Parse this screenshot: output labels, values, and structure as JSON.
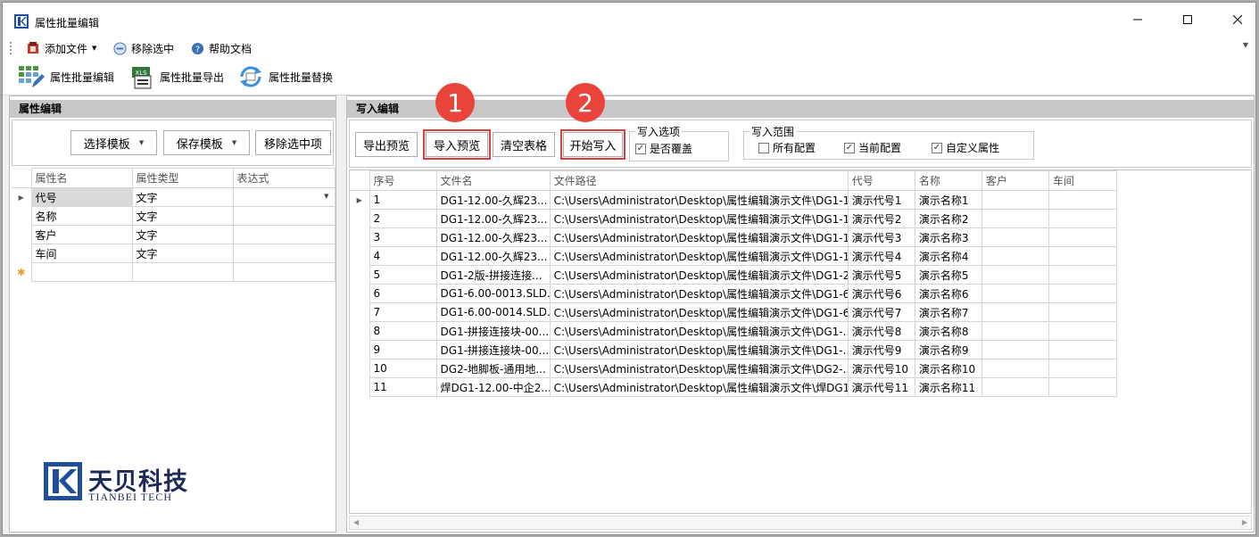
{
  "window": {
    "title": "属性批量编辑"
  },
  "menu": {
    "add_file": "添加文件",
    "remove_selected": "移除选中",
    "help_doc": "帮助文档"
  },
  "ribbon": {
    "batch_edit": "属性批量编辑",
    "batch_export": "属性批量导出",
    "batch_replace": "属性批量替换"
  },
  "left_panel": {
    "title": "属性编辑",
    "select_template": "选择模板",
    "save_template": "保存模板",
    "remove_item": "移除选中项",
    "columns": [
      "属性名",
      "属性类型",
      "表达式"
    ],
    "rows": [
      {
        "name": "代号",
        "type": "文字",
        "expr": ""
      },
      {
        "name": "名称",
        "type": "文字",
        "expr": ""
      },
      {
        "name": "客户",
        "type": "文字",
        "expr": ""
      },
      {
        "name": "车间",
        "type": "文字",
        "expr": ""
      }
    ],
    "new_row_marker": "✱"
  },
  "logo": {
    "cn": "天贝科技",
    "en": "TIANBEI TECH"
  },
  "right_panel": {
    "title": "写入编辑",
    "export_preview": "导出预览",
    "import_preview": "导入预览",
    "clear_table": "清空表格",
    "start_write": "开始写入",
    "write_options": {
      "legend": "写入选项",
      "overwrite": "是否覆盖",
      "overwrite_checked": true
    },
    "write_scope": {
      "legend": "写入范围",
      "all_config": "所有配置",
      "all_checked": false,
      "current_config": "当前配置",
      "current_checked": true,
      "custom_props": "自定义属性",
      "custom_checked": true
    },
    "badge1": "1",
    "badge2": "2",
    "columns": [
      "序号",
      "文件名",
      "文件路径",
      "代号",
      "名称",
      "客户",
      "车间"
    ],
    "rows": [
      [
        "1",
        "DG1-12.00-久辉23...",
        "C:\\Users\\Administrator\\Desktop\\属性编辑演示文件\\DG1-1...",
        "演示代号1",
        "演示名称1",
        "",
        ""
      ],
      [
        "2",
        "DG1-12.00-久辉23...",
        "C:\\Users\\Administrator\\Desktop\\属性编辑演示文件\\DG1-1...",
        "演示代号2",
        "演示名称2",
        "",
        ""
      ],
      [
        "3",
        "DG1-12.00-久辉23...",
        "C:\\Users\\Administrator\\Desktop\\属性编辑演示文件\\DG1-1...",
        "演示代号3",
        "演示名称3",
        "",
        ""
      ],
      [
        "4",
        "DG1-12.00-久辉23...",
        "C:\\Users\\Administrator\\Desktop\\属性编辑演示文件\\DG1-1...",
        "演示代号4",
        "演示名称4",
        "",
        ""
      ],
      [
        "5",
        "DG1-2版-拼接连接...",
        "C:\\Users\\Administrator\\Desktop\\属性编辑演示文件\\DG1-2...",
        "演示代号5",
        "演示名称5",
        "",
        ""
      ],
      [
        "6",
        "DG1-6.00-0013.SLD...",
        "C:\\Users\\Administrator\\Desktop\\属性编辑演示文件\\DG1-6...",
        "演示代号6",
        "演示名称6",
        "",
        ""
      ],
      [
        "7",
        "DG1-6.00-0014.SLD...",
        "C:\\Users\\Administrator\\Desktop\\属性编辑演示文件\\DG1-6...",
        "演示代号7",
        "演示名称7",
        "",
        ""
      ],
      [
        "8",
        "DG1-拼接连接块-00...",
        "C:\\Users\\Administrator\\Desktop\\属性编辑演示文件\\DG1-...",
        "演示代号8",
        "演示名称8",
        "",
        ""
      ],
      [
        "9",
        "DG1-拼接连接块-00...",
        "C:\\Users\\Administrator\\Desktop\\属性编辑演示文件\\DG1-...",
        "演示代号9",
        "演示名称9",
        "",
        ""
      ],
      [
        "10",
        "DG2-地脚板-通用地...",
        "C:\\Users\\Administrator\\Desktop\\属性编辑演示文件\\DG2-...",
        "演示代号10",
        "演示名称10",
        "",
        ""
      ],
      [
        "11",
        "焊DG1-12.00-中企2...",
        "C:\\Users\\Administrator\\Desktop\\属性编辑演示文件\\焊DG1...",
        "演示代号11",
        "演示名称11",
        "",
        ""
      ]
    ]
  },
  "colors": {
    "highlight": "#e03b3b",
    "badge": "#e8443a",
    "logo": "#1d2a57"
  }
}
